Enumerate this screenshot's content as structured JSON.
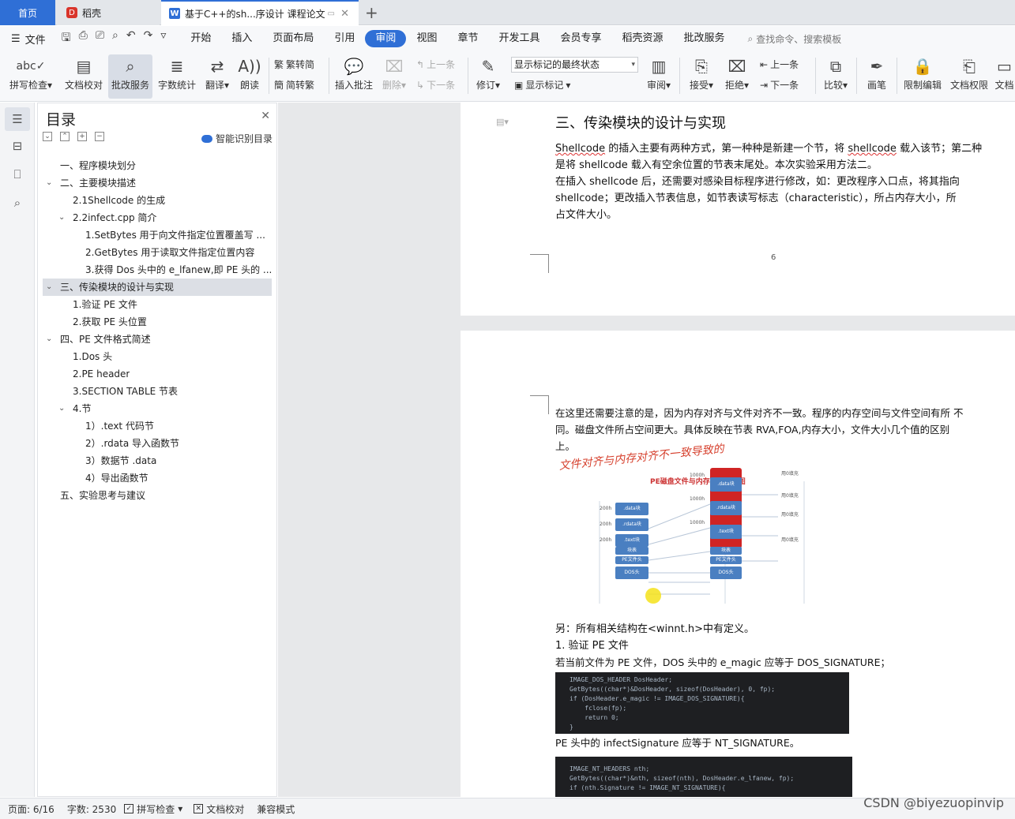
{
  "tabs": {
    "home": "首页",
    "doc": "稻壳",
    "active": "基于C++的sh...序设计 课程论文"
  },
  "menu": {
    "file": "文件",
    "items": [
      "开始",
      "插入",
      "页面布局",
      "引用",
      "审阅",
      "视图",
      "章节",
      "开发工具",
      "会员专享",
      "稻壳资源",
      "批改服务"
    ],
    "active_index": 4,
    "search": "查找命令、搜索模板"
  },
  "ribbon": {
    "spell": "拼写检查",
    "doc_check": "文档校对",
    "review_service": "批改服务",
    "word_count": "字数统计",
    "translate": "翻译",
    "read": "朗读",
    "trad": "繁转简",
    "simp": "简转繁",
    "insert_comment": "插入批注",
    "delete": "删除",
    "prev": "上一条",
    "next": "下一条",
    "revise": "修订",
    "show_select": "显示标记的最终状态",
    "show_mark": "显示标记",
    "review": "审阅",
    "accept": "接受",
    "reject": "拒绝",
    "prev2": "上一条",
    "next2": "下一条",
    "compare": "比较",
    "pen": "画笔",
    "restrict": "限制编辑",
    "doc_rights": "文档权限",
    "doc_more": "文档"
  },
  "toc": {
    "title": "目录",
    "smart": "智能识别目录",
    "items": [
      {
        "text": "一、程序模块划分",
        "level": 1,
        "caret": ""
      },
      {
        "text": "二、主要模块描述",
        "level": 1,
        "caret": "v"
      },
      {
        "text": "2.1Shellcode 的生成",
        "level": 2,
        "caret": ""
      },
      {
        "text": "2.2infect.cpp 简介",
        "level": 2,
        "caret": "v"
      },
      {
        "text": "1.SetBytes 用于向文件指定位置覆盖写 ...",
        "level": 3,
        "caret": ""
      },
      {
        "text": "2.GetBytes 用于读取文件指定位置内容",
        "level": 3,
        "caret": ""
      },
      {
        "text": "3.获得 Dos 头中的 e_lfanew,即 PE 头的 ...",
        "level": 3,
        "caret": ""
      },
      {
        "text": "三、传染模块的设计与实现",
        "level": 1,
        "caret": "v",
        "selected": true
      },
      {
        "text": "1.验证 PE 文件",
        "level": 2,
        "caret": ""
      },
      {
        "text": "2.获取 PE 头位置",
        "level": 2,
        "caret": ""
      },
      {
        "text": "四、PE 文件格式简述",
        "level": 1,
        "caret": "v"
      },
      {
        "text": "1.Dos 头",
        "level": 2,
        "caret": ""
      },
      {
        "text": "2.PE header",
        "level": 2,
        "caret": ""
      },
      {
        "text": "3.SECTION TABLE 节表",
        "level": 2,
        "caret": ""
      },
      {
        "text": "4.节",
        "level": 2,
        "caret": "v"
      },
      {
        "text": "1）.text 代码节",
        "level": 3,
        "caret": ""
      },
      {
        "text": "2）.rdata 导入函数节",
        "level": 3,
        "caret": ""
      },
      {
        "text": "3）数据节 .data",
        "level": 3,
        "caret": ""
      },
      {
        "text": "4）导出函数节",
        "level": 3,
        "caret": ""
      },
      {
        "text": "五、实验思考与建议",
        "level": 1,
        "caret": ""
      }
    ]
  },
  "doc": {
    "heading": "三、传染模块的设计与实现",
    "p1_a": "Shellcode",
    "p1_b": " 的插入主要有两种方式，第一种种是新建一个节，将 ",
    "p1_c": "shellcode",
    "p1_d": " 载入该节；第二种",
    "p1_line2": "是将 shellcode 载入有空余位置的节表末尾处。本次实验采用方法二。",
    "p2_line1": "在插入 shellcode 后，还需要对感染目标程序进行修改，如：更改程序入口点，将其指向",
    "p2_line2": "shellcode；更改插入节表信息，如节表读写标志（characteristic），所占内存大小，所",
    "p2_line3": "占文件大小。",
    "page_num": "6",
    "p3_line1": "在这里还需要注意的是，因为内存对齐与文件对齐不一致。程序的内存空间与文件空间有所    不",
    "p3_line2": "同。磁盘文件所占空间更大。具体反映在节表 RVA,FOA,内存大小，文件大小几个值的区别",
    "p3_line3": "上。",
    "fig_handwriting": "文件对齐与内存对齐不一致导致的",
    "fig_title": "PE磁盘文件与内存映像结构图",
    "fig_left_labels": [
      ".data块",
      ".rdata块",
      ".text块",
      "块表",
      "PE文件头",
      "DOS头"
    ],
    "fig_right_labels": [
      ".data块",
      ".rdata块",
      ".text块",
      "块表",
      "PE文件头",
      "DOS头"
    ],
    "fig_sizes_left": [
      "200h",
      "200h",
      "200h"
    ],
    "fig_sizes_right": [
      "1000h",
      "1000h",
      "1000h"
    ],
    "fig_fill": [
      "用0填充",
      "用0填充",
      "用0填充",
      "用0填充"
    ],
    "p4": "另：所有相关结构在<winnt.h>中有定义。",
    "p5": "1.  验证 PE 文件",
    "p6": "若当前文件为 PE 文件，DOS 头中的 e_magic 应等于 DOS_SIGNATURE；",
    "code1": "IMAGE_DOS_HEADER DosHeader;\nGetBytes((char*)&DosHeader, sizeof(DosHeader), 0, fp);\nif (DosHeader.e_magic != IMAGE_DOS_SIGNATURE){\n    fclose(fp);\n    return 0;\n}",
    "p7": "PE 头中的 infectSignature 应等于 NT_SIGNATURE。",
    "code2": "IMAGE_NT_HEADERS nth;\nGetBytes((char*)&nth, sizeof(nth), DosHeader.e_lfanew, fp);\nif (nth.Signature != IMAGE_NT_SIGNATURE){"
  },
  "status": {
    "page": "页面: 6/16",
    "words": "字数: 2530",
    "spell": "拼写检查",
    "check": "文档校对",
    "compat": "兼容模式"
  },
  "watermark": "CSDN @biyezuopinvip"
}
